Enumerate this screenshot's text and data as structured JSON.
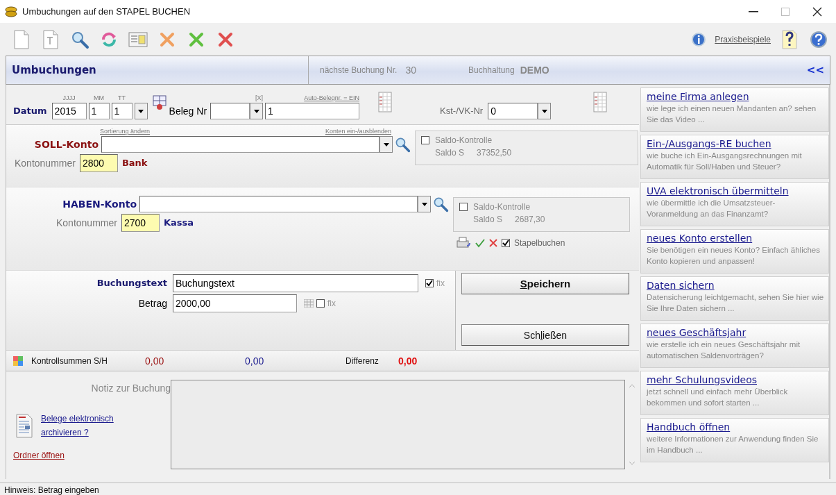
{
  "window": {
    "title": "Umbuchungen auf den STAPEL BUCHEN"
  },
  "toolbar": {
    "help_link": "Praxisbeispiele"
  },
  "header": {
    "title": "Umbuchungen",
    "next_label": "nächste Buchung Nr.",
    "next_value": "30",
    "books_label": "Buchhaltung",
    "books_value": "DEMO",
    "collapse": "<<"
  },
  "date_row": {
    "label": "Datum",
    "year_hint": "JJJJ",
    "month_hint": "MM",
    "day_hint": "TT",
    "year": "2015",
    "month": "1",
    "day": "1",
    "beleg_label": "Beleg Nr",
    "x_hint": "[X]",
    "auto_hint": "Auto-Belegnr. = EIN",
    "beleg_value": "1",
    "kst_label": "Kst-/VK-Nr",
    "kst_value": "0"
  },
  "accounts": [
    {
      "kind": "soll",
      "sort_link": "Sortierung ändern",
      "toggle_link": "Konten ein-/ausblenden",
      "label": "SOLL-Konto",
      "number_label": "Kontonummer",
      "number": "2800",
      "name": "Bank",
      "saldo_check": {
        "checked": false,
        "label": "Saldo-Kontrolle"
      },
      "saldo_label": "Saldo S",
      "saldo_value": "37352,50"
    },
    {
      "kind": "haben",
      "label": "HABEN-Konto",
      "number_label": "Kontonummer",
      "number": "2700",
      "name": "Kassa",
      "saldo_check": {
        "checked": false,
        "label": "Saldo-Kontrolle"
      },
      "saldo_label": "Saldo S",
      "saldo_value": "2687,30"
    }
  ],
  "stapel": {
    "checked": true,
    "label": "Stapelbuchen"
  },
  "buchungstext": {
    "label": "Buchungstext",
    "value": "Buchungstext",
    "fix": {
      "checked": true,
      "label": "fix"
    }
  },
  "betrag": {
    "label": "Betrag",
    "value": "2000,00",
    "fix": {
      "checked": false,
      "label": "fix"
    }
  },
  "buttons": [
    {
      "key": "S",
      "after": "peichern",
      "bold": true
    },
    {
      "before": "Sch",
      "key": "l",
      "after": "ießen",
      "bold": false
    }
  ],
  "totals": {
    "label": "Kontrollsummen S/H",
    "soll": "0,00",
    "haben": "0,00",
    "diff_label": "Differenz",
    "diff": "0,00"
  },
  "note": {
    "label": "Notiz zur Buchung",
    "archive_link": "Belege elektronisch archivieren ?",
    "folder_link": "Ordner öffnen"
  },
  "sidebar": {
    "items": [
      {
        "title": "meine Firma anlegen",
        "desc": "wie lege ich einen neuen Mandanten an? sehen Sie das Video ..."
      },
      {
        "title": "Ein-/Ausgangs-RE buchen",
        "desc": "wie buche ich Ein-Ausgangsrechnungen mit Automatik für Soll/Haben und Steuer?"
      },
      {
        "title": "UVA elektronisch übermitteln",
        "desc": "wie übermittle ich die Umsatzsteuer-Voranmeldung an das Finanzamt?"
      },
      {
        "title": "neues Konto erstellen",
        "desc": "Sie benötigen ein neues Konto? Einfach ähliches Konto kopieren und anpassen!"
      },
      {
        "title": "Daten sichern",
        "desc": "Datensicherung leichtgemacht, sehen Sie hier wie Sie Ihre Daten sichern ..."
      },
      {
        "title": "neues Geschäftsjahr",
        "desc": "wie erstelle ich ein neues Geschäftsjahr mit automatischen Saldenvorträgen?"
      },
      {
        "title": "mehr Schulungsvideos",
        "desc": "jetzt schnell und einfach mehr Überblick bekommen und sofort starten ..."
      },
      {
        "title": "Handbuch öffnen",
        "desc": "weitere Informationen zur Anwendung finden Sie im Handbuch ..."
      }
    ]
  },
  "status_bar": {
    "text": "Hinweis: Betrag eingeben"
  }
}
